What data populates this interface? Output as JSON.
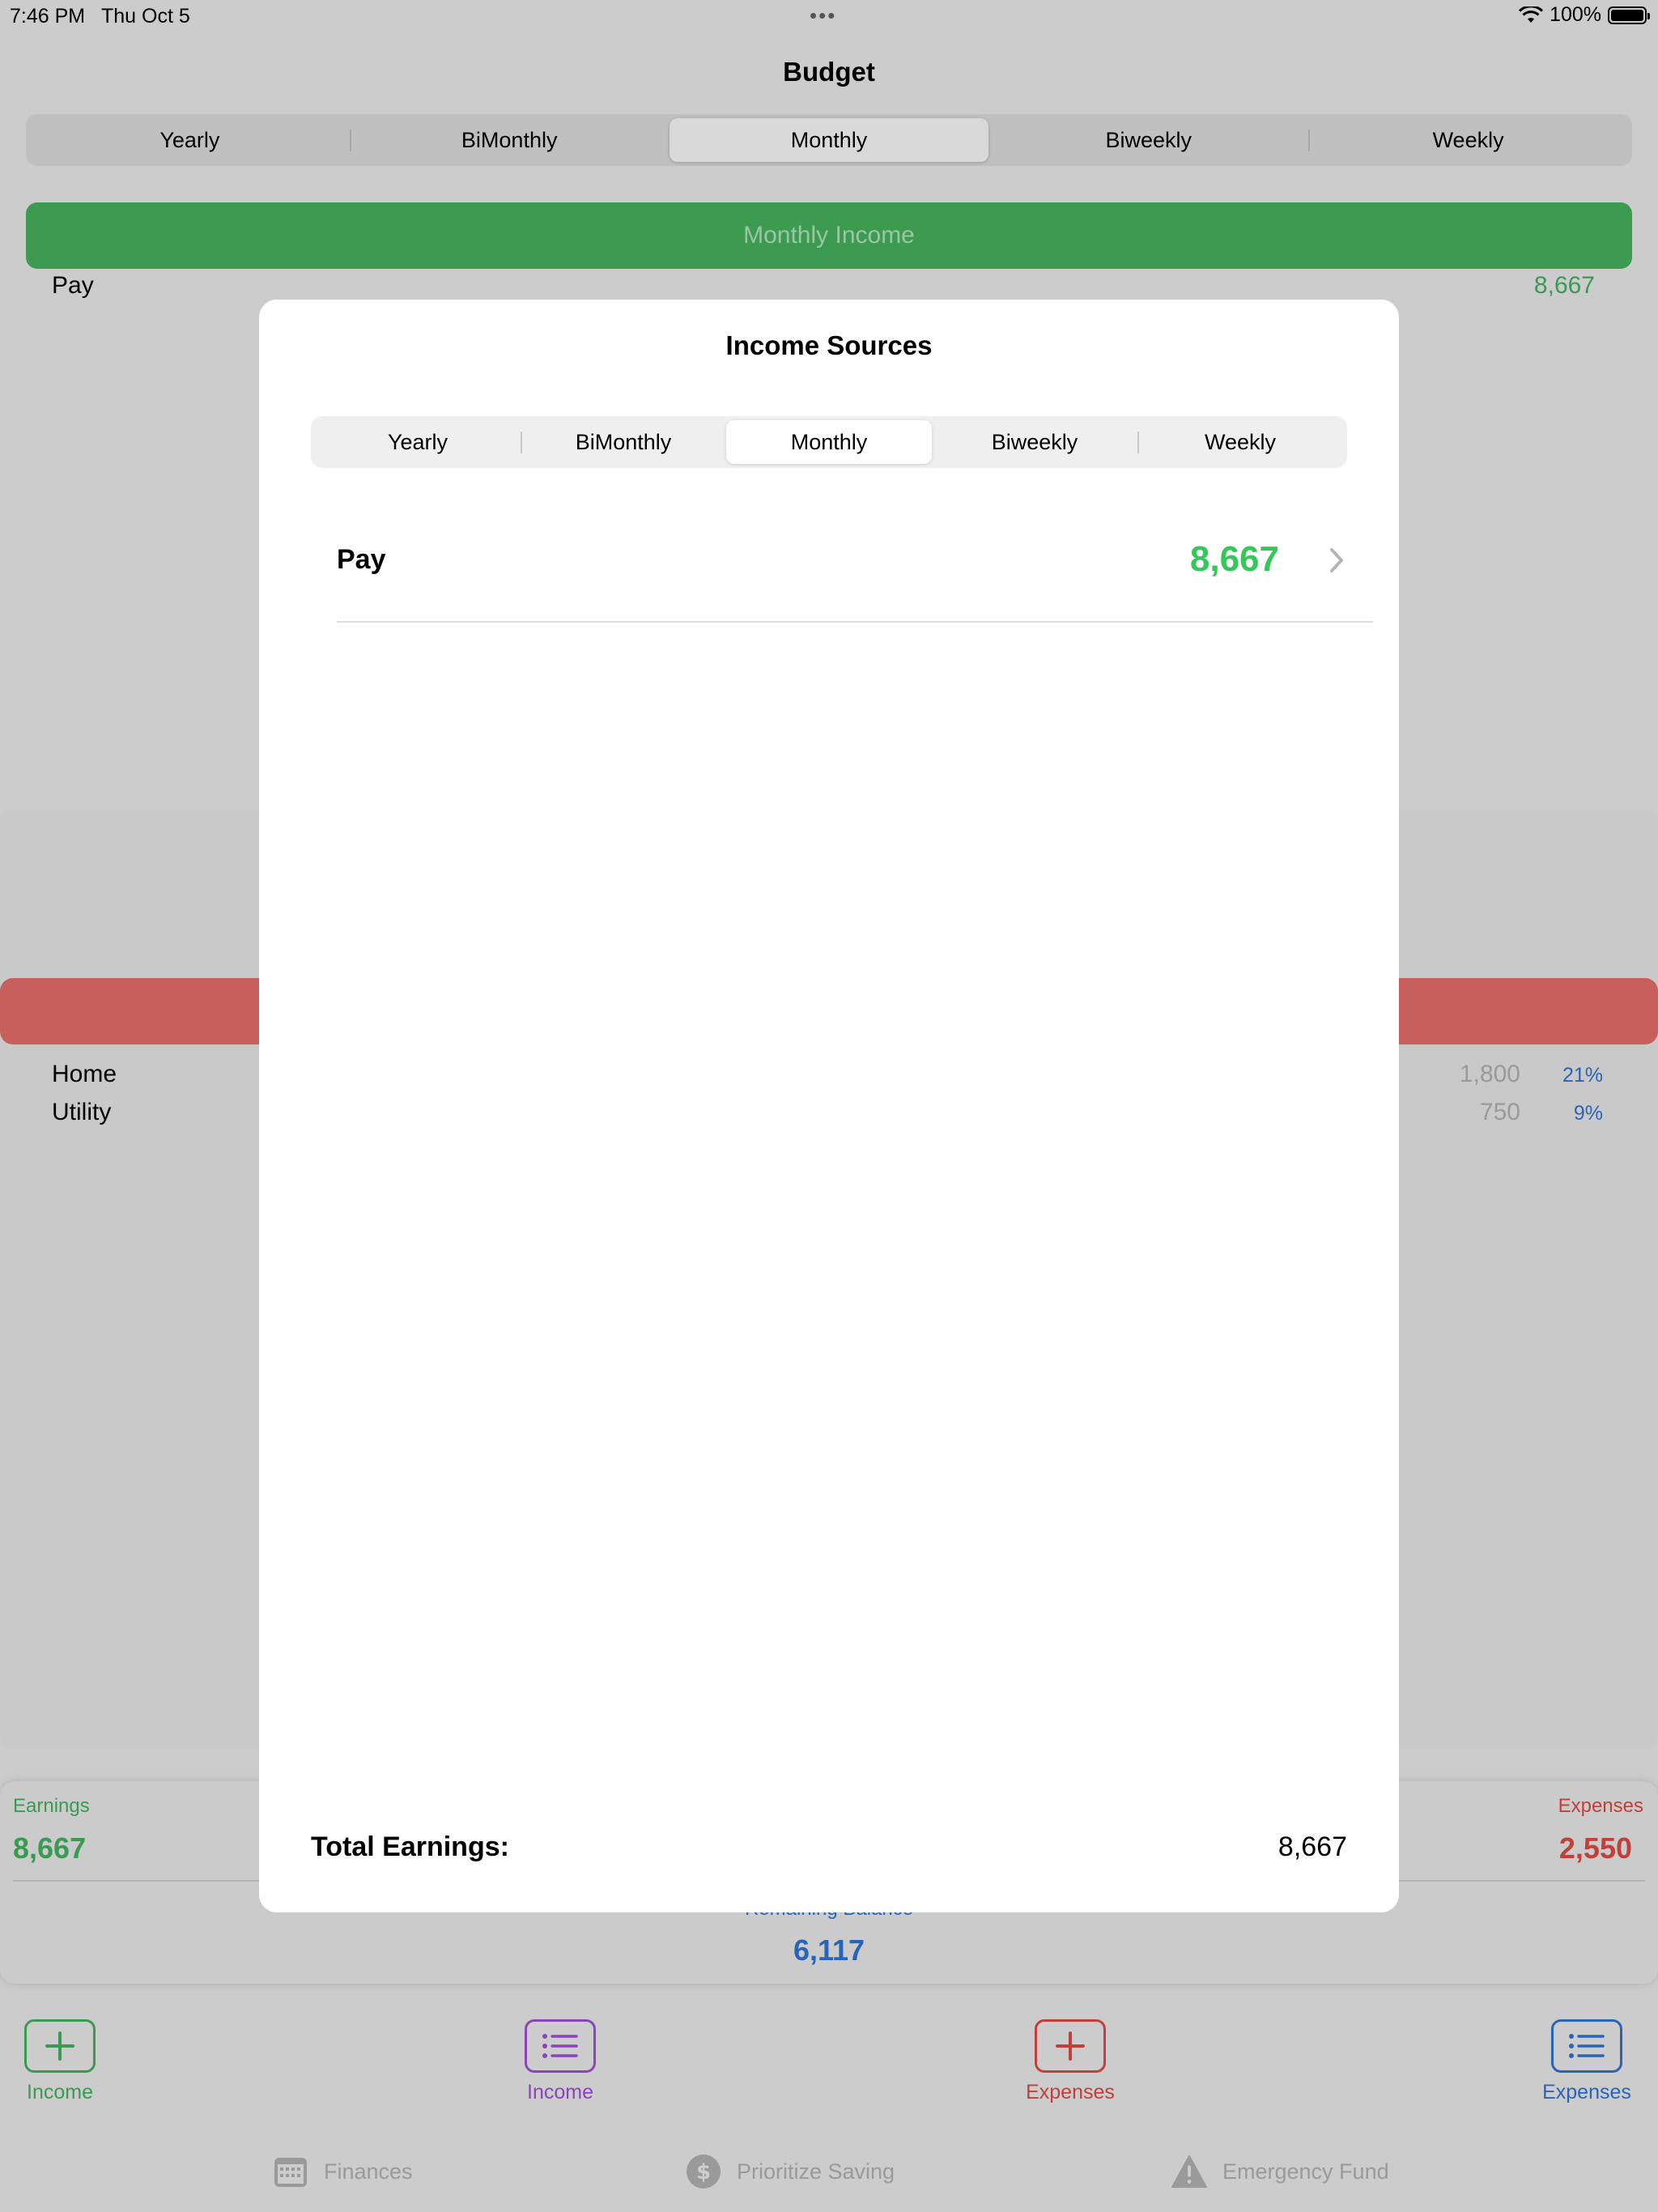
{
  "status_bar": {
    "time": "7:46 PM",
    "date": "Thu Oct 5",
    "battery": "100%"
  },
  "app": {
    "title": "Budget",
    "period_tabs": [
      "Yearly",
      "BiMonthly",
      "Monthly",
      "Biweekly",
      "Weekly"
    ],
    "selected_period": "Monthly",
    "income_banner": "Monthly Income",
    "income_items": [
      {
        "label": "Pay",
        "value": "8,667"
      }
    ],
    "expense_items": [
      {
        "label": "Home",
        "value": "1,800",
        "percent": "21%"
      },
      {
        "label": "Utility",
        "value": "750",
        "percent": "9%"
      }
    ],
    "summary": {
      "earnings_label": "Earnings",
      "earnings_value": "8,667",
      "expenses_label": "Expenses",
      "expenses_value": "2,550",
      "remaining_label": "Remaining Balance",
      "remaining_value": "6,117"
    },
    "actions": {
      "income_add": "Income",
      "income_list": "Income",
      "expenses_add": "Expenses",
      "expenses_list": "Expenses"
    },
    "tabs": [
      "Finances",
      "Prioritize Saving",
      "Emergency Fund"
    ]
  },
  "modal": {
    "title": "Income Sources",
    "period_tabs": [
      "Yearly",
      "BiMonthly",
      "Monthly",
      "Biweekly",
      "Weekly"
    ],
    "selected_period": "Monthly",
    "sources": [
      {
        "label": "Pay",
        "value": "8,667"
      }
    ],
    "total_label": "Total Earnings:",
    "total_value": "8,667"
  },
  "colors": {
    "income_green": "#34c759",
    "expense_red": "#c0403a",
    "balance_blue": "#2a64b6",
    "income_list_purple": "#8a45b8"
  }
}
